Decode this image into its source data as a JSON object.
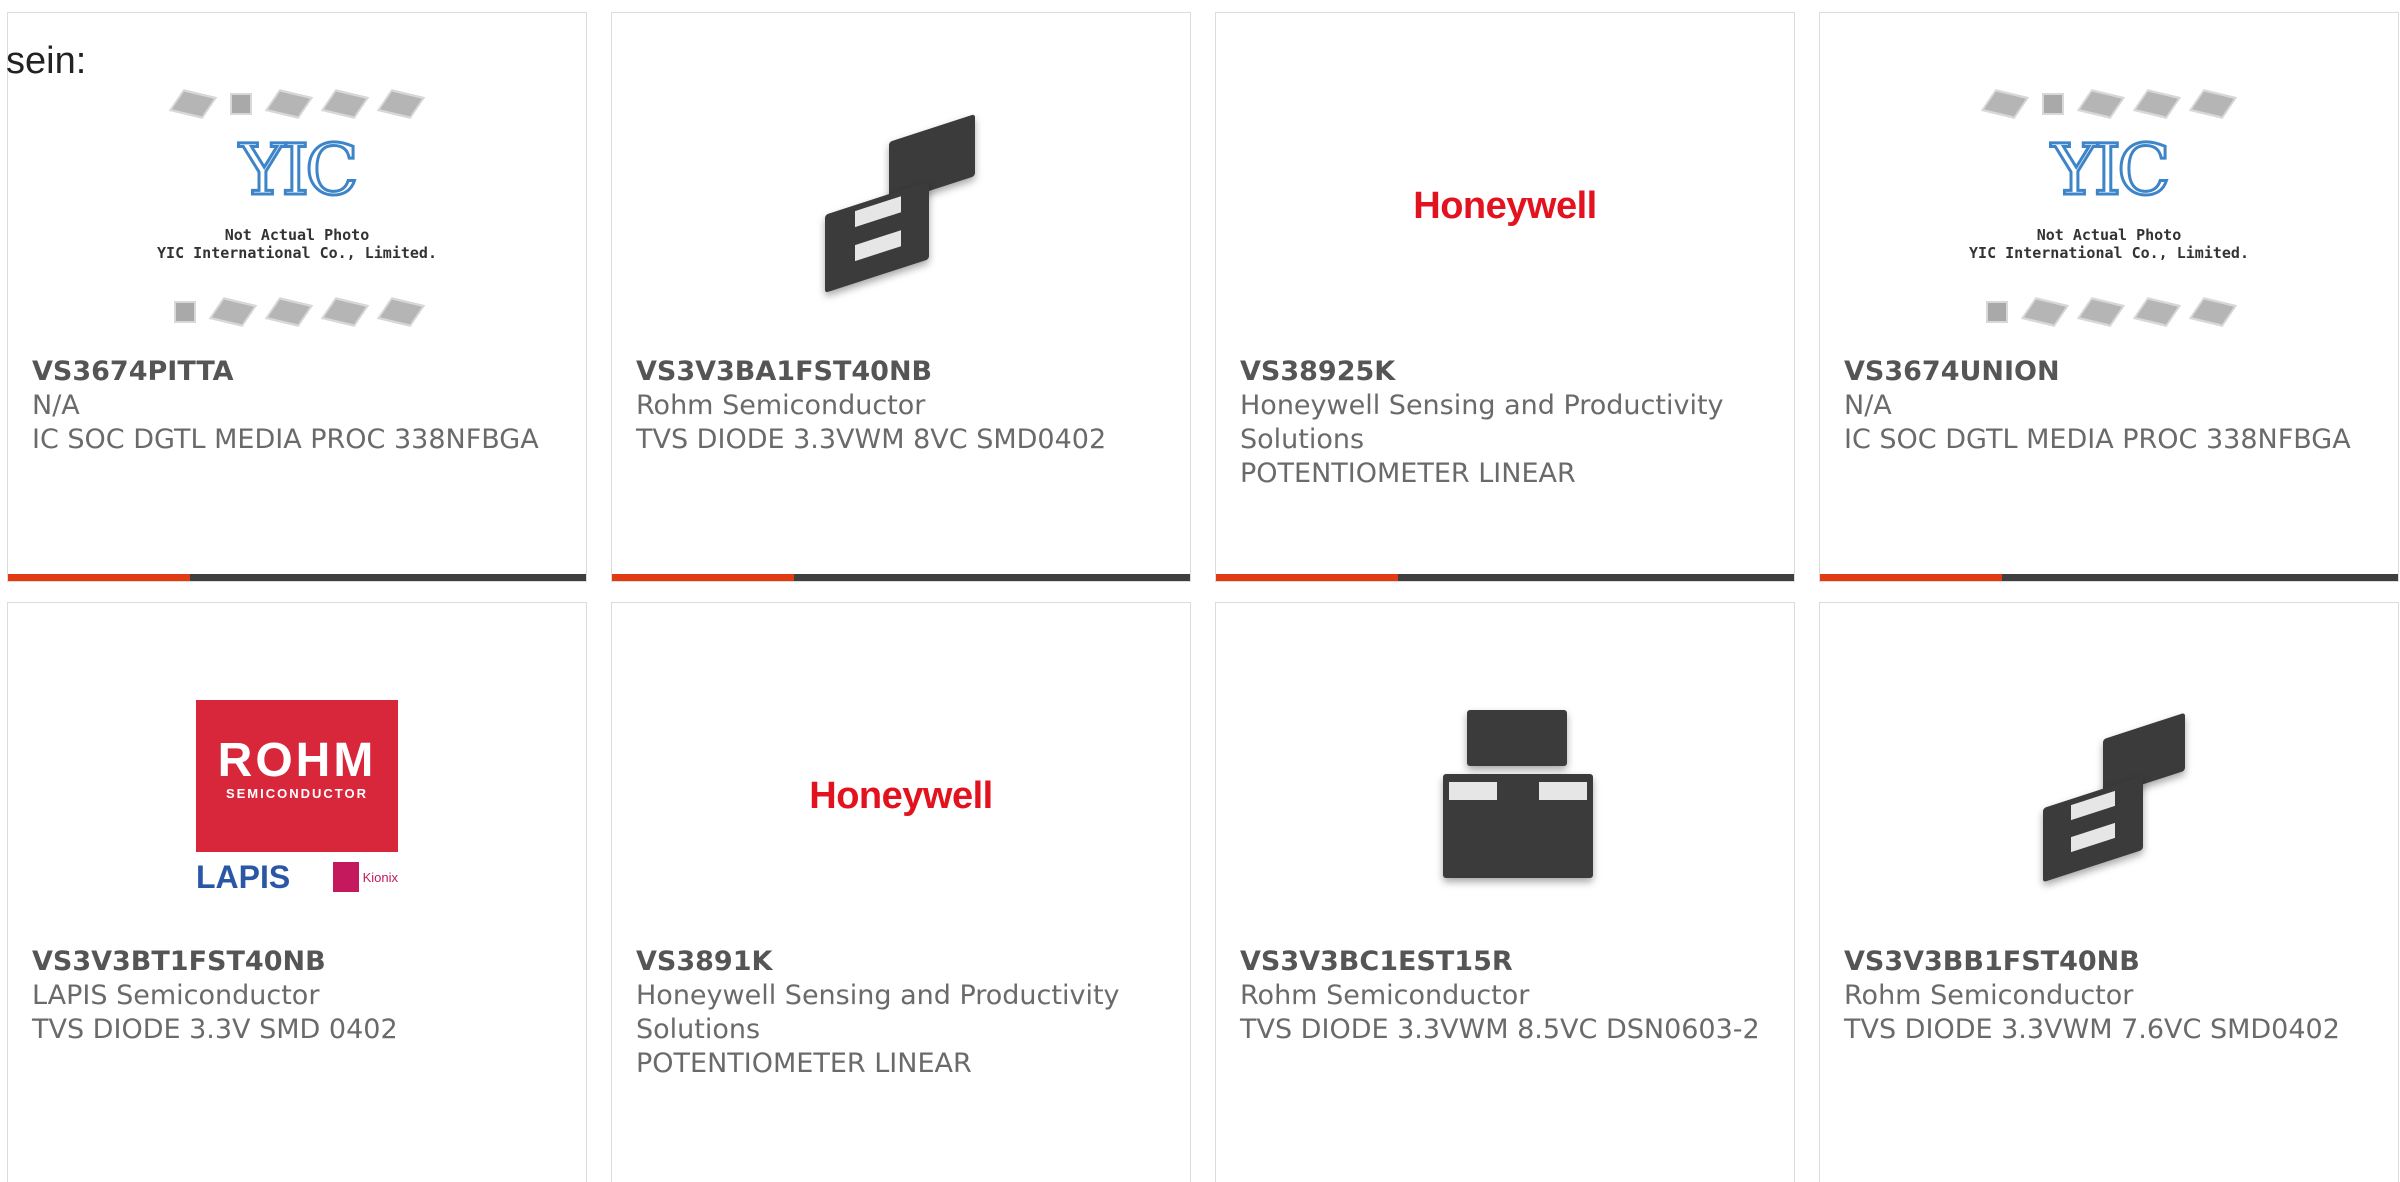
{
  "intro_text": "sein:",
  "placeholder_image": {
    "logo_text": "YIC",
    "note_line1": "Not Actual Photo",
    "note_line2": "YIC International Co., Limited."
  },
  "brand_logos": {
    "honeywell": "Honeywell",
    "rohm": "ROHM",
    "rohm_sub": "SEMICONDUCTOR",
    "lapis": "LAPIS",
    "kionix": "Kionix"
  },
  "colors": {
    "accent": "#e23b13",
    "bar_dark": "#3f3f3f",
    "honeywell_red": "#e3121f"
  },
  "products": [
    {
      "part_number": "VS3674PITTA",
      "manufacturer": "N/A",
      "description": "IC SOC DGTL MEDIA PROC 338NFBGA",
      "image": "placeholder-photo"
    },
    {
      "part_number": "VS3V3BA1FST40NB",
      "manufacturer": "Rohm Semiconductor",
      "description": "TVS DIODE 3.3VWM 8VC SMD0402",
      "image": "diode-package"
    },
    {
      "part_number": "VS38925K",
      "manufacturer": "Honeywell Sensing and Productivity Solutions",
      "description": "POTENTIOMETER LINEAR",
      "image": "honeywell-logo"
    },
    {
      "part_number": "VS3674UNION",
      "manufacturer": "N/A",
      "description": "IC SOC DGTL MEDIA PROC 338NFBGA",
      "image": "placeholder-photo"
    },
    {
      "part_number": "VS3V3BT1FST40NB",
      "manufacturer": "LAPIS Semiconductor",
      "description": "TVS DIODE 3.3V SMD 0402",
      "image": "rohm-lapis-logo"
    },
    {
      "part_number": "VS3891K",
      "manufacturer": "Honeywell Sensing and Productivity Solutions",
      "description": "POTENTIOMETER LINEAR",
      "image": "honeywell-logo"
    },
    {
      "part_number": "VS3V3BC1EST15R",
      "manufacturer": "Rohm Semiconductor",
      "description": "TVS DIODE 3.3VWM 8.5VC DSN0603-2",
      "image": "diode-package"
    },
    {
      "part_number": "VS3V3BB1FST40NB",
      "manufacturer": "Rohm Semiconductor",
      "description": "TVS DIODE 3.3VWM 7.6VC SMD0402",
      "image": "diode-package"
    }
  ]
}
